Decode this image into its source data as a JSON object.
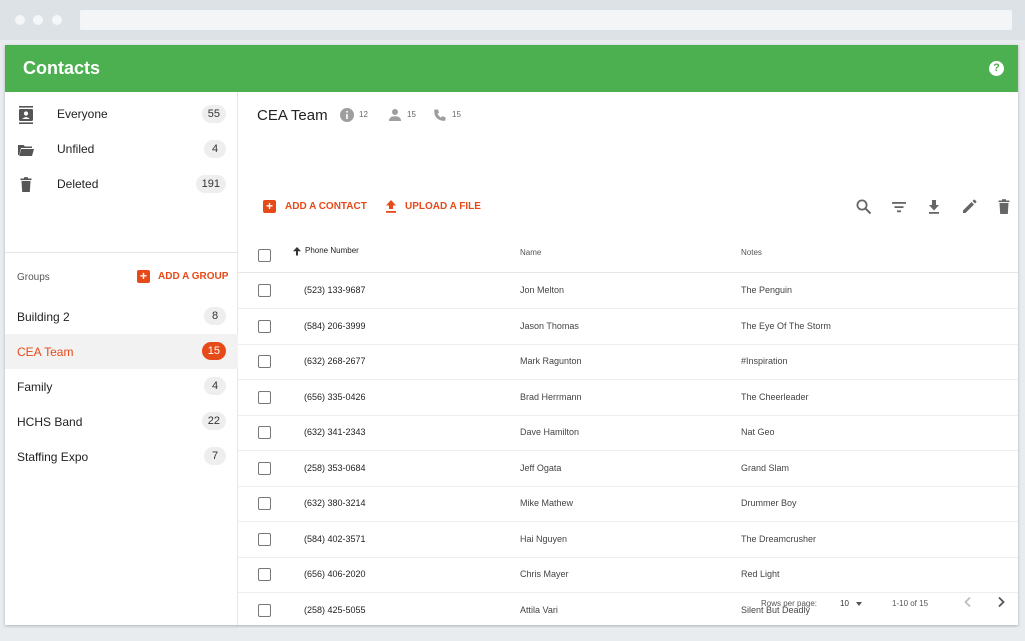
{
  "app": {
    "title": "Contacts",
    "help_glyph": "?"
  },
  "sidebar": {
    "items": [
      {
        "label": "Everyone",
        "count": "55",
        "icon": "contacts-icon"
      },
      {
        "label": "Unfiled",
        "count": "4",
        "icon": "folder-open-icon"
      },
      {
        "label": "Deleted",
        "count": "191",
        "icon": "trash-icon"
      }
    ],
    "groups_label": "Groups",
    "add_group_label": "ADD A GROUP",
    "groups": [
      {
        "label": "Building 2",
        "count": "8"
      },
      {
        "label": "CEA Team",
        "count": "15",
        "active": true
      },
      {
        "label": "Family",
        "count": "4"
      },
      {
        "label": "HCHS Band",
        "count": "22"
      },
      {
        "label": "Staffing Expo",
        "count": "7"
      }
    ]
  },
  "group": {
    "title": "CEA Team",
    "stats": {
      "info_count": "12",
      "person_count": "15",
      "phone_count": "15"
    }
  },
  "actions": {
    "add_contact_label": "ADD A CONTACT",
    "upload_file_label": "UPLOAD A FILE"
  },
  "table": {
    "columns": {
      "phone": "Phone Number",
      "name": "Name",
      "notes": "Notes"
    },
    "sorted_by": "Phone Number",
    "rows": [
      {
        "phone": "(523) 133-9687",
        "name": "Jon Melton",
        "notes": "The Penguin"
      },
      {
        "phone": "(584) 206-3999",
        "name": "Jason Thomas",
        "notes": "The Eye Of The Storm"
      },
      {
        "phone": "(632) 268-2677",
        "name": "Mark Ragunton",
        "notes": "#Inspiration"
      },
      {
        "phone": "(656) 335-0426",
        "name": "Brad Herrmann",
        "notes": "The Cheerleader"
      },
      {
        "phone": "(632) 341-2343",
        "name": "Dave Hamilton",
        "notes": "Nat Geo"
      },
      {
        "phone": "(258) 353-0684",
        "name": "Jeff Ogata",
        "notes": "Grand Slam"
      },
      {
        "phone": "(632) 380-3214",
        "name": "Mike Mathew",
        "notes": "Drummer Boy"
      },
      {
        "phone": "(584) 402-3571",
        "name": "Hai Nguyen",
        "notes": "The Dreamcrusher"
      },
      {
        "phone": "(656) 406-2020",
        "name": "Chris Mayer",
        "notes": "Red Light"
      },
      {
        "phone": "(258) 425-5055",
        "name": "Attila Vari",
        "notes": "Silent But Deadly"
      }
    ]
  },
  "pagination": {
    "rows_per_page_label": "Rows per page:",
    "rows_per_page_value": "10",
    "range_label": "1-10 of 15"
  },
  "colors": {
    "header_green": "#4caf50",
    "accent_orange": "#e64a19"
  }
}
